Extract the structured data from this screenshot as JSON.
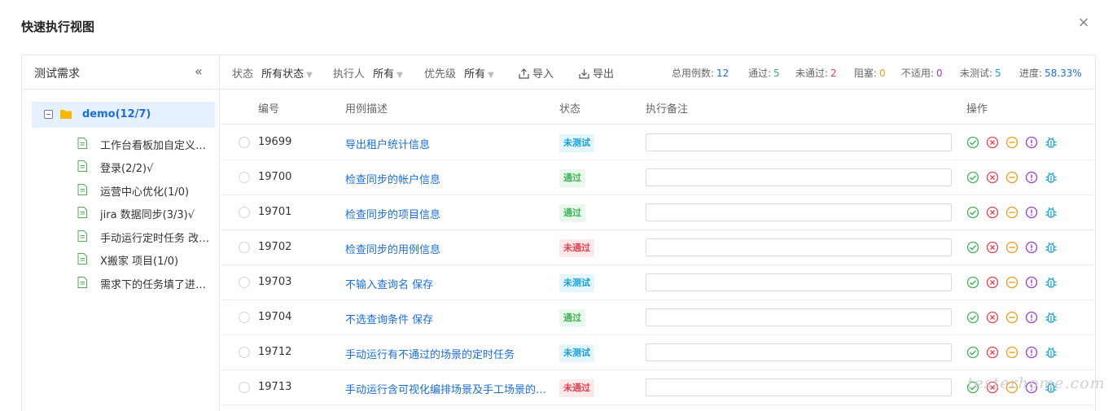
{
  "dialog": {
    "title": "快速执行视图",
    "close": "×"
  },
  "sidebar": {
    "title": "测试需求",
    "collapse": "«",
    "root": {
      "label": "demo(12/7)"
    },
    "items": [
      {
        "label": "工作台看板加自定义…"
      },
      {
        "label": "登录(2/2)√"
      },
      {
        "label": "运营中心优化(1/0)"
      },
      {
        "label": "jira 数据同步(3/3)√"
      },
      {
        "label": "手动运行定时任务 改…"
      },
      {
        "label": "X搬家 项目(1/0)"
      },
      {
        "label": "需求下的任务填了进…"
      }
    ]
  },
  "toolbar": {
    "status_label": "状态",
    "status_value": "所有状态",
    "executor_label": "执行人",
    "executor_value": "所有",
    "priority_label": "优先级",
    "priority_value": "所有",
    "import": "导入",
    "export": "导出"
  },
  "stats": {
    "total_label": "总用例数:",
    "total": "12",
    "pass_label": "通过:",
    "pass": "5",
    "fail_label": "未通过:",
    "fail": "2",
    "blocked_label": "阻塞:",
    "blocked": "0",
    "na_label": "不适用:",
    "na": "0",
    "untested_label": "未测试:",
    "untested": "5",
    "progress_label": "进度:",
    "progress": "58.33%"
  },
  "colors": {
    "pass": "#3fb356",
    "fail": "#e8404f",
    "blocked": "#f39c12",
    "na": "#9b3bd6",
    "untested": "#16a1d8",
    "link": "#1a6fe0"
  },
  "table": {
    "headers": {
      "id": "编号",
      "desc": "用例描述",
      "status": "状态",
      "note": "执行备注",
      "ops": "操作"
    },
    "rows": [
      {
        "id": "19699",
        "desc": "导出租户统计信息",
        "status": "未测试",
        "kind": "untested"
      },
      {
        "id": "19700",
        "desc": "检查同步的帐户信息",
        "status": "通过",
        "kind": "pass"
      },
      {
        "id": "19701",
        "desc": "检查同步的项目信息",
        "status": "通过",
        "kind": "pass"
      },
      {
        "id": "19702",
        "desc": "检查同步的用例信息",
        "status": "未通过",
        "kind": "fail"
      },
      {
        "id": "19703",
        "desc": "不输入查询名 保存",
        "status": "未测试",
        "kind": "untested"
      },
      {
        "id": "19704",
        "desc": "不选查询条件 保存",
        "status": "通过",
        "kind": "pass"
      },
      {
        "id": "19712",
        "desc": "手动运行有不通过的场景的定时任务",
        "status": "未测试",
        "kind": "untested"
      },
      {
        "id": "19713",
        "desc": "手动运行含可视化编排场景及手工场景的…",
        "status": "未通过",
        "kind": "fail"
      }
    ]
  },
  "watermark": "testerhome.com"
}
